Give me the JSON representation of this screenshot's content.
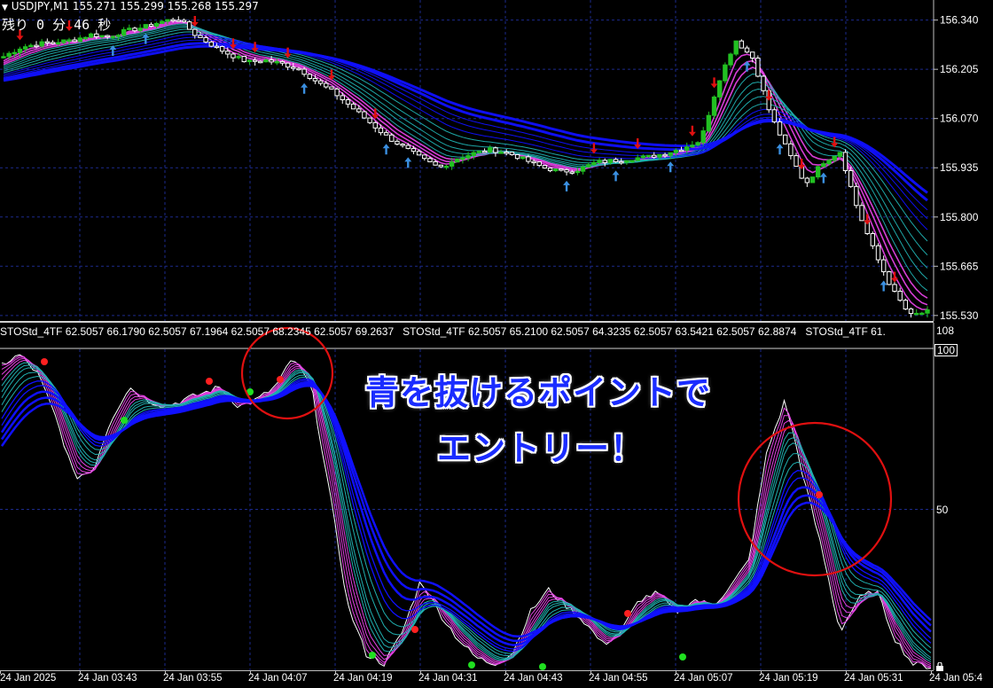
{
  "header": {
    "symbol_prefix": "▼",
    "quote": "USDJPY,M1  155.271 155.299 155.268 155.297",
    "timer": "残り 0 分 46 秒"
  },
  "main_axis": {
    "ticks": [
      "156.340",
      "156.205",
      "156.070",
      "155.935",
      "155.800",
      "155.665",
      "155.530"
    ],
    "values": [
      156.34,
      156.205,
      156.07,
      155.935,
      155.8,
      155.665,
      155.53
    ],
    "current_price": "155.297"
  },
  "sub_header": "STOStd_4TF 62.5057 66.1790 62.5057 67.1964 62.5057 68.2345 62.5057 69.2637   STOStd_4TF 62.5057 65.2100 62.5057 64.3235 62.5057 63.5421 62.5057 62.8874   STOStd_4TF 61.",
  "sub_axis": {
    "ticks": [
      "108",
      "100",
      "50"
    ]
  },
  "x_axis": {
    "ticks": [
      "24 Jan 2025",
      "24 Jan 03:43",
      "24 Jan 03:55",
      "24 Jan 04:07",
      "24 Jan 04:19",
      "24 Jan 04:31",
      "24 Jan 04:43",
      "24 Jan 04:55",
      "24 Jan 05:07",
      "24 Jan 05:19",
      "24 Jan 05:31",
      "24 Jan 05:4"
    ]
  },
  "annotation": {
    "line1": "青を抜けるポイントで",
    "line2": "エントリー！"
  },
  "colors": {
    "background": "#000000",
    "grid": "#1c2a8c",
    "bull": "#22c022",
    "bear": "#ffffff",
    "slow_band": "#1010ff",
    "fast_band": "#e040e0",
    "mid_band": "#20b0b0",
    "annotation_text": "#1a2cff",
    "circle": "#e01010",
    "sell_arrow": "#e01010",
    "buy_arrow": "#3a8fe0"
  },
  "chart_data": [
    {
      "type": "candlestick",
      "title": "USDJPY,M1",
      "ylim": [
        155.515,
        156.395
      ],
      "ticks": [
        156.34,
        156.205,
        156.07,
        155.935,
        155.8,
        155.665,
        155.53
      ],
      "x_labels": [
        "24 Jan 2025",
        "24 Jan 03:43",
        "24 Jan 03:55",
        "24 Jan 04:07",
        "24 Jan 04:19",
        "24 Jan 04:31",
        "24 Jan 04:43",
        "24 Jan 04:55",
        "24 Jan 05:07",
        "24 Jan 05:19",
        "24 Jan 05:31",
        "24 Jan 05:4"
      ],
      "close_path": [
        156.24,
        156.265,
        156.275,
        156.28,
        156.285,
        156.3,
        156.295,
        156.31,
        156.32,
        156.335,
        156.345,
        156.3,
        156.27,
        156.245,
        156.225,
        156.23,
        156.22,
        156.205,
        156.17,
        156.14,
        156.1,
        156.06,
        156.02,
        155.99,
        155.96,
        155.935,
        155.96,
        155.975,
        155.985,
        155.975,
        155.955,
        155.935,
        155.925,
        155.93,
        155.95,
        155.955,
        155.96,
        155.965,
        155.975,
        155.99,
        156.01,
        156.17,
        156.285,
        156.235,
        156.08,
        155.98,
        155.89,
        155.95,
        155.98,
        155.82,
        155.7,
        155.6,
        155.53,
        155.54
      ],
      "grid": true
    },
    {
      "type": "line",
      "title": "STOStd_4TF",
      "ylim": [
        0,
        108
      ],
      "ticks": [
        100,
        50
      ],
      "stochastic_path": [
        95,
        98,
        92,
        78,
        60,
        62,
        78,
        88,
        84,
        82,
        84,
        86,
        88,
        82,
        84,
        88,
        97,
        88,
        55,
        20,
        5,
        2,
        12,
        28,
        18,
        10,
        4,
        2,
        5,
        18,
        25,
        20,
        15,
        8,
        12,
        22,
        24,
        18,
        22,
        20,
        26,
        34,
        68,
        84,
        60,
        38,
        12,
        22,
        25,
        10,
        2,
        1
      ],
      "grid": true
    }
  ]
}
